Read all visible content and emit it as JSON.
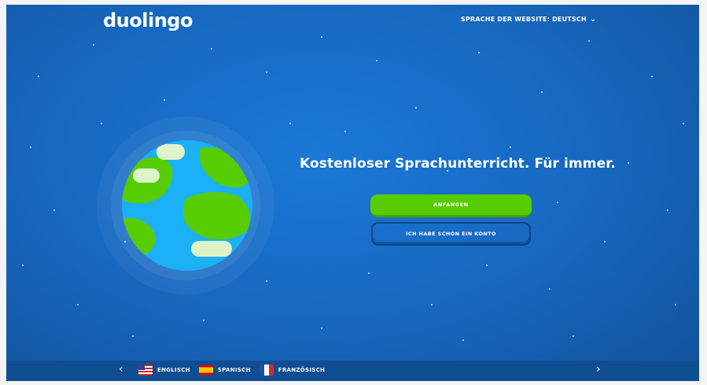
{
  "header": {
    "logo_text": "duolingo",
    "site_language_label": "SPRACHE DER WEBSITE: DEUTSCH"
  },
  "main": {
    "headline": "Kostenloser Sprachunterricht. Für immer.",
    "primary_button": "ANFANGEN",
    "secondary_button": "ICH HABE SCHON EIN KONTO"
  },
  "footer": {
    "prev_arrow": "‹",
    "next_arrow": "›",
    "languages": [
      {
        "label": "ENGLISCH",
        "flag": "us-flag-icon"
      },
      {
        "label": "SPANISCH",
        "flag": "spain-flag-icon"
      },
      {
        "label": "FRANZÖSISCH",
        "flag": "france-flag-icon"
      }
    ]
  },
  "colors": {
    "background": "#1766bd",
    "primary_button": "#58cc02",
    "footer": "#0f4e92",
    "globe_ocean": "#1cb0f6",
    "globe_land": "#58cc02"
  }
}
